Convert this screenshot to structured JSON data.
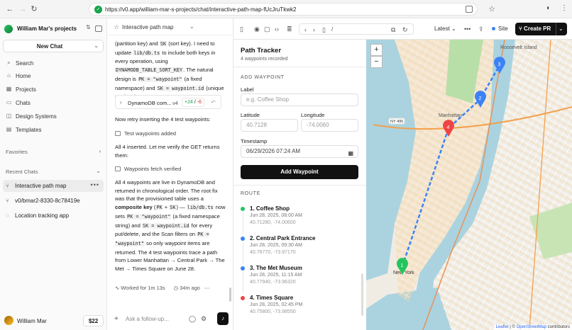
{
  "browser": {
    "url": "https://v0.app/william-mar-s-projects/chat/interactive-path-map-fUcJruTkwk2"
  },
  "sidebar": {
    "workspace": "William Mar's projects",
    "new_chat": "New Chat",
    "nav": [
      {
        "label": "Search",
        "icon": "search-icon"
      },
      {
        "label": "Home",
        "icon": "home-icon"
      },
      {
        "label": "Projects",
        "icon": "projects-icon"
      },
      {
        "label": "Chats",
        "icon": "chats-icon"
      },
      {
        "label": "Design Systems",
        "icon": "design-systems-icon"
      },
      {
        "label": "Templates",
        "icon": "templates-icon"
      }
    ],
    "favorites_label": "Favorites",
    "recent_label": "Recent Chats",
    "recent": [
      {
        "label": "Interactive path map"
      },
      {
        "label": "v0/bmar2-8330-8c78419e"
      },
      {
        "label": "Location tracking app"
      }
    ],
    "user_name": "William Mar",
    "credits": "$22"
  },
  "chat": {
    "title": "Interactive path map",
    "file_card": {
      "name": "DynamoDB com...",
      "version": "v4",
      "added": "+24",
      "slash": "/",
      "removed": "-6"
    },
    "msg_retry": "Now retry inserting the 4 test waypoints:",
    "tool_added": "Test waypoints added",
    "msg_verify": "All 4 inserted. Let me verify the GET returns them:",
    "tool_verified": "Waypoints fetch verified",
    "worked": "Worked for 1m 13s",
    "time_ago": "34m ago",
    "composer_placeholder": "Ask a follow-up..."
  },
  "toolbar": {
    "path": "/",
    "version_label": "Latest",
    "site_label": "Site",
    "create_pr": "Create PR"
  },
  "app": {
    "title": "Path Tracker",
    "count": "4 waypoints recorded",
    "add_section": "ADD WAYPOINT",
    "label_label": "Label",
    "label_placeholder": "e.g. Coffee Shop",
    "lat_label": "Latitude",
    "lat_placeholder": "40.7128",
    "lng_label": "Longitude",
    "lng_placeholder": "-74.0060",
    "ts_label": "Timestamp",
    "ts_value": "06/29/2026 07:24 AM",
    "add_button": "Add Waypoint",
    "route_section": "ROUTE",
    "route": [
      {
        "num": "1.",
        "name": "Coffee Shop",
        "date": "Jun 28, 2025, 08:00 AM",
        "coords": "40.71280, -74.00600",
        "color": "#22c55e"
      },
      {
        "num": "2.",
        "name": "Central Park Entrance",
        "date": "Jun 28, 2025, 09:30 AM",
        "coords": "40.76770, -73.97170",
        "color": "#3b82f6"
      },
      {
        "num": "3.",
        "name": "The Met Museum",
        "date": "Jun 28, 2025, 11:15 AM",
        "coords": "40.77940, -73.96320",
        "color": "#3b82f6"
      },
      {
        "num": "4.",
        "name": "Times Square",
        "date": "Jun 28, 2025, 02:45 PM",
        "coords": "40.75800, -73.98550",
        "color": "#ef4444"
      }
    ]
  },
  "map": {
    "zoom_in": "+",
    "zoom_out": "−",
    "labels": [
      {
        "text": "Manhattan"
      },
      {
        "text": "Roosevelt Island"
      },
      {
        "text": "New York"
      },
      {
        "text": "NY 495"
      }
    ],
    "markers": [
      {
        "num": "1",
        "color": "#22c55e"
      },
      {
        "num": "2",
        "color": "#3b82f6"
      },
      {
        "num": "3",
        "color": "#3b82f6"
      },
      {
        "num": "4",
        "color": "#ef4444"
      }
    ],
    "attribution": {
      "leaflet": "Leaflet",
      "sep": "|",
      "copy": "©",
      "osm": "OpenStreetMap",
      "suffix": "contributors"
    }
  },
  "colors": {
    "accent": "#111111",
    "start": "#22c55e",
    "mid": "#3b82f6",
    "end": "#ef4444",
    "route_line": "#3b82f6"
  }
}
